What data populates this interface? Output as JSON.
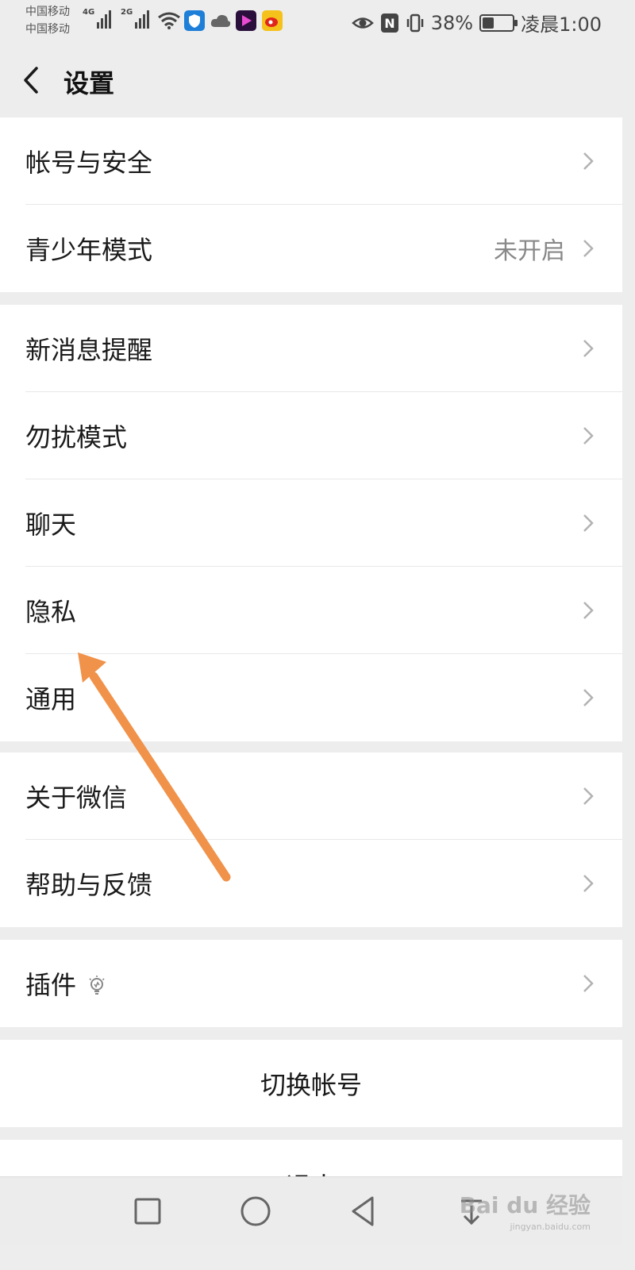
{
  "status_bar": {
    "carrier_1": "中国移动",
    "carrier_2": "中国移动",
    "net_1": "4G",
    "net_2": "2G",
    "battery_pct": "38%",
    "battery_level": 0.38,
    "time": "凌晨1:00",
    "nfc": "N"
  },
  "nav": {
    "title": "设置"
  },
  "groups": [
    {
      "items": [
        {
          "label": "帐号与安全",
          "value": ""
        },
        {
          "label": "青少年模式",
          "value": "未开启"
        }
      ]
    },
    {
      "items": [
        {
          "label": "新消息提醒",
          "value": ""
        },
        {
          "label": "勿扰模式",
          "value": ""
        },
        {
          "label": "聊天",
          "value": ""
        },
        {
          "label": "隐私",
          "value": ""
        },
        {
          "label": "通用",
          "value": ""
        }
      ]
    },
    {
      "items": [
        {
          "label": "关于微信",
          "value": ""
        },
        {
          "label": "帮助与反馈",
          "value": ""
        }
      ]
    },
    {
      "items": [
        {
          "label": "插件",
          "value": ""
        }
      ]
    }
  ],
  "actions": {
    "switch_account": "切换帐号",
    "logout": "退出"
  },
  "watermark": {
    "text": "Bai du 经验",
    "sub": "jingyan.baidu.com"
  },
  "colors": {
    "background": "#ededed",
    "card": "#ffffff",
    "annotation_arrow": "#f0924a",
    "secondary_text": "#888888"
  }
}
